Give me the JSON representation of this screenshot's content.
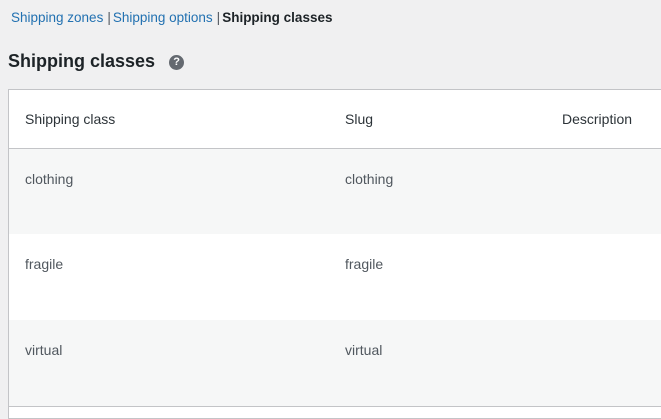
{
  "subnav": {
    "items": [
      {
        "label": "Shipping zones"
      },
      {
        "label": "Shipping options"
      },
      {
        "label": "Shipping classes"
      }
    ],
    "separator": "|"
  },
  "page": {
    "title": "Shipping classes",
    "help_icon": "help-icon",
    "help_glyph": "?"
  },
  "table": {
    "columns": [
      "Shipping class",
      "Slug",
      "Description"
    ],
    "rows": [
      {
        "class": "clothing",
        "slug": "clothing",
        "description": ""
      },
      {
        "class": "fragile",
        "slug": "fragile",
        "description": ""
      },
      {
        "class": "virtual",
        "slug": "virtual",
        "description": ""
      }
    ]
  },
  "colors": {
    "link": "#2271b1",
    "background": "#f0f0f1",
    "help_icon": "#646970"
  }
}
